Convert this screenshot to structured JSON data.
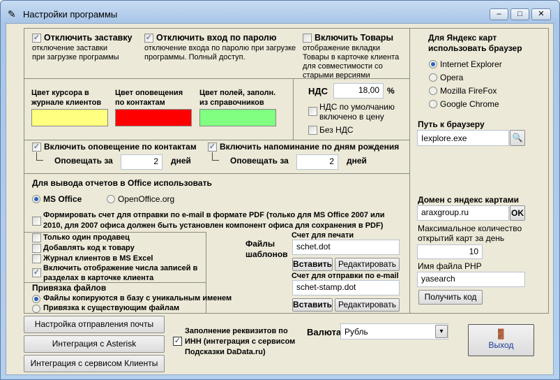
{
  "window": {
    "title": "Настройки программы"
  },
  "general": {
    "disable_splash": {
      "label": "Отключить заставку",
      "desc1": "отключение заставки",
      "desc2": "при загрузке программы",
      "checked": true
    },
    "disable_password": {
      "label": "Отключить вход по паролю",
      "desc1": "отключение входа по паролю при загрузке",
      "desc2": "программы. Полный доступ.",
      "checked": true
    },
    "enable_goods": {
      "label": "Включить Товары",
      "desc": [
        "отображение вкладки",
        "Товары в карточке клиента",
        "для совместимости со",
        "старыми версиями"
      ],
      "checked": false
    }
  },
  "colors": {
    "cursor": {
      "l1": "Цвет курсора в",
      "l2": "журнале клиентов",
      "color": "#ffff80"
    },
    "alert": {
      "l1": "Цвет оповещения",
      "l2": "по контактам",
      "color": "#ff0000"
    },
    "fields": {
      "l1": "Цвет полей, заполн.",
      "l2": "из справочников",
      "color": "#80ff80"
    }
  },
  "vat": {
    "label": "НДС",
    "value": "18,00",
    "unit": "%",
    "included_l1": "НДС по умолчанию",
    "included_l2": "включено в цену",
    "no_vat": "Без НДС"
  },
  "notify": {
    "contacts": {
      "label": "Включить оповещение по контактам",
      "sub": "Оповещать за",
      "value": "2",
      "unit": "дней",
      "checked": true
    },
    "birthdays": {
      "label": "Включить напоминание по дням рождения",
      "sub": "Оповещать за",
      "value": "2",
      "unit": "дней",
      "checked": true
    }
  },
  "office": {
    "title": "Для вывода отчетов в Office использовать",
    "options": [
      "MS Office",
      "OpenOffice.org"
    ],
    "selected": "MS Office",
    "pdf_l1": "Формировать счет для отправки по e-mail в формате PDF (только для MS Office 2007 или",
    "pdf_l2": "2010, для 2007 офиса должен быть установлен компонент офиса для  сохранения в PDF)"
  },
  "options": [
    {
      "label": "Только один продавец",
      "checked": false
    },
    {
      "label": "Добавлять код к товару",
      "checked": false
    },
    {
      "label": "Журнал клиентов в MS Excel",
      "checked": false
    },
    {
      "label": "Включить отображение числа записей в",
      "label2": "разделах в карточке клиента",
      "checked": true
    }
  ],
  "file_binding": {
    "title": "Привязка файлов",
    "options": [
      "Файлы копируются в базу с уникальным именем",
      "Привязка к существующим файлам"
    ],
    "selected": 0
  },
  "templates": {
    "title1": "Файлы",
    "title2": "шаблонов",
    "print_label": "Счет для печати",
    "print_value": "schet.dot",
    "email_label": "Счет для отправки по e-mail",
    "email_value": "schet-stamp.dot",
    "insert": "Вставить",
    "edit": "Редактировать"
  },
  "browser": {
    "title1": "Для Яндекс карт",
    "title2": "использовать браузер",
    "options": [
      "Internet Explorer",
      "Opera",
      "Mozilla FireFox",
      "Google Chrome"
    ],
    "selected": 0,
    "path_label": "Путь к браузеру",
    "path_value": "Iexplore.exe"
  },
  "yandex": {
    "domain_label": "Домен с яндекс картами",
    "domain_value": "araxgroup.ru",
    "ok": "OK",
    "max_l1": "Максимальное количество",
    "max_l2": "открытий карт за день",
    "max_value": "10",
    "php_label": "Имя файла PHP",
    "php_value": "yasearch",
    "get_code": "Получить код"
  },
  "bottom": {
    "mail_settings": "Настройка отправления почты",
    "asterisk": "Интеграция с Asterisk",
    "clients": "Интеграция с сервисом Клиенты",
    "inn_l1": "Заполнение реквизитов по",
    "inn_l2": "ИНН (интеграция с сервисом",
    "inn_l3": "Подсказки DaData.ru)",
    "inn_checked": true,
    "currency_label": "Валюта",
    "currency_value": "Рубль",
    "exit": "Выход"
  }
}
